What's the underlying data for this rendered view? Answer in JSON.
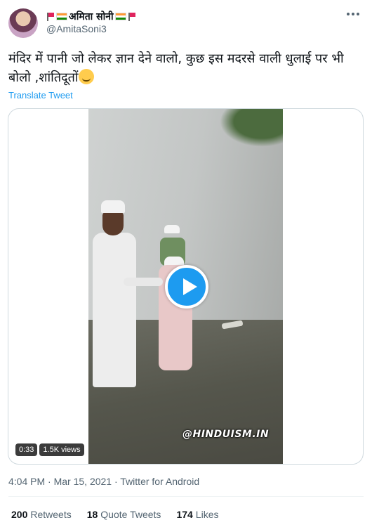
{
  "user": {
    "display_name": "अमिता सोनी",
    "handle": "@AmitaSoni3"
  },
  "tweet": {
    "text": "मंदिर में पानी जो लेकर ज्ञान देने वालो, कुछ इस मदरसे वाली धुलाई पर भी बोलो ,शांतिदूतों",
    "translate_label": "Translate Tweet"
  },
  "video": {
    "duration": "0:33",
    "views": "1.5K views",
    "watermark": "@HINDUISM.IN"
  },
  "meta": {
    "time": "4:04 PM",
    "date": "Mar 15, 2021",
    "source": "Twitter for Android"
  },
  "stats": {
    "retweets": {
      "count": "200",
      "label": "Retweets"
    },
    "quotes": {
      "count": "18",
      "label": "Quote Tweets"
    },
    "likes": {
      "count": "174",
      "label": "Likes"
    }
  },
  "colors": {
    "accent": "#1d9bf0",
    "muted": "#536471"
  }
}
